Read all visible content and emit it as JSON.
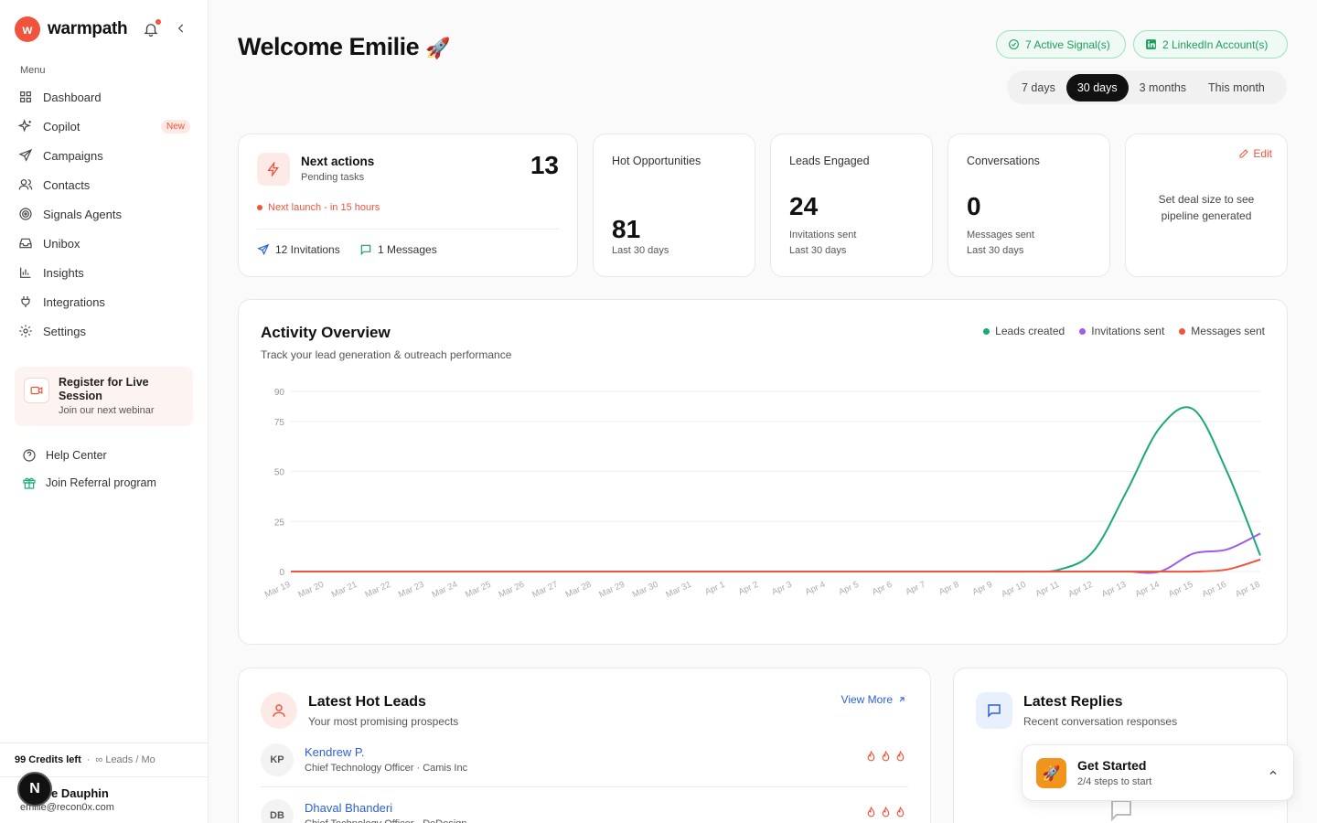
{
  "brand": {
    "logo_letter": "w",
    "name": "warmpath"
  },
  "sidebar": {
    "menu_label": "Menu",
    "items": [
      {
        "label": "Dashboard",
        "icon": "grid-icon"
      },
      {
        "label": "Copilot",
        "icon": "sparkles-icon",
        "badge": "New"
      },
      {
        "label": "Campaigns",
        "icon": "send-icon"
      },
      {
        "label": "Contacts",
        "icon": "users-icon"
      },
      {
        "label": "Signals Agents",
        "icon": "radar-icon"
      },
      {
        "label": "Unibox",
        "icon": "inbox-icon"
      },
      {
        "label": "Insights",
        "icon": "bar-chart-icon"
      },
      {
        "label": "Integrations",
        "icon": "plug-icon"
      },
      {
        "label": "Settings",
        "icon": "gear-icon"
      }
    ],
    "webinar": {
      "title": "Register for Live Session",
      "subtitle": "Join our next webinar"
    },
    "help": "Help Center",
    "referral": "Join Referral program",
    "credits": {
      "left": "99 Credits left",
      "sep": "·",
      "leads": "∞ Leads / Mo"
    },
    "user": {
      "name": "e Dauphin",
      "email": "emilie@recon0x.com",
      "badge": "N"
    }
  },
  "header": {
    "welcome": "Welcome Emilie",
    "rocket": "🚀",
    "signals_pill": "7 Active Signal(s)",
    "linkedin_pill": "2 LinkedIn Account(s)",
    "ranges": [
      "7 days",
      "30 days",
      "3 months",
      "This month"
    ],
    "active_range": "30 days"
  },
  "next_actions": {
    "title": "Next actions",
    "subtitle": "Pending tasks",
    "count": "13",
    "launch": "Next launch - in 15 hours",
    "invitations": "12 Invitations",
    "messages": "1 Messages"
  },
  "stats": [
    {
      "title": "Hot Opportunities",
      "value": "81",
      "sub1": "Last 30 days",
      "sub2": ""
    },
    {
      "title": "Leads Engaged",
      "value": "24",
      "sub1": "Invitations sent",
      "sub2": "Last 30 days"
    },
    {
      "title": "Conversations",
      "value": "0",
      "sub1": "Messages sent",
      "sub2": "Last 30 days"
    }
  ],
  "deal": {
    "edit": "Edit",
    "text": "Set deal size to see pipeline generated"
  },
  "activity": {
    "title": "Activity Overview",
    "subtitle": "Track your lead generation & outreach performance",
    "legend": [
      {
        "name": "Leads created",
        "color": "#1aa978"
      },
      {
        "name": "Invitations sent",
        "color": "#9b5de5"
      },
      {
        "name": "Messages sent",
        "color": "#f0543c"
      }
    ]
  },
  "chart_data": {
    "type": "line",
    "x": [
      "Mar 19",
      "Mar 20",
      "Mar 21",
      "Mar 22",
      "Mar 23",
      "Mar 24",
      "Mar 25",
      "Mar 26",
      "Mar 27",
      "Mar 28",
      "Mar 29",
      "Mar 30",
      "Mar 31",
      "Apr 1",
      "Apr 2",
      "Apr 3",
      "Apr 4",
      "Apr 5",
      "Apr 6",
      "Apr 7",
      "Apr 8",
      "Apr 9",
      "Apr 10",
      "Apr 11",
      "Apr 12",
      "Apr 13",
      "Apr 14",
      "Apr 15",
      "Apr 16",
      "Apr 18"
    ],
    "y_ticks": [
      0,
      25,
      50,
      75,
      90
    ],
    "ylim": [
      0,
      90
    ],
    "grid": true,
    "series": [
      {
        "name": "Leads created",
        "color": "#1aa978",
        "values": [
          0,
          0,
          0,
          0,
          0,
          0,
          0,
          0,
          0,
          0,
          0,
          0,
          0,
          0,
          0,
          0,
          0,
          0,
          0,
          0,
          0,
          0,
          0,
          1,
          10,
          40,
          72,
          81,
          50,
          8
        ]
      },
      {
        "name": "Invitations sent",
        "color": "#9b5de5",
        "values": [
          0,
          0,
          0,
          0,
          0,
          0,
          0,
          0,
          0,
          0,
          0,
          0,
          0,
          0,
          0,
          0,
          0,
          0,
          0,
          0,
          0,
          0,
          0,
          0,
          0,
          0,
          0,
          9,
          11,
          19
        ]
      },
      {
        "name": "Messages sent",
        "color": "#f0543c",
        "values": [
          0,
          0,
          0,
          0,
          0,
          0,
          0,
          0,
          0,
          0,
          0,
          0,
          0,
          0,
          0,
          0,
          0,
          0,
          0,
          0,
          0,
          0,
          0,
          0,
          0,
          0,
          0,
          0,
          1,
          6
        ]
      }
    ]
  },
  "hot_leads": {
    "title": "Latest Hot Leads",
    "subtitle": "Your most promising prospects",
    "view_more": "View More",
    "rows": [
      {
        "initials": "KP",
        "name": "Kendrew P.",
        "role": "Chief Technology Officer · Camis Inc"
      },
      {
        "initials": "DB",
        "name": "Dhaval Bhanderi",
        "role": "Chief Technology Officer · DeDesign"
      }
    ]
  },
  "replies": {
    "title": "Latest Replies",
    "subtitle": "Recent conversation responses"
  },
  "get_started": {
    "title": "Get Started",
    "subtitle": "2/4 steps to start",
    "icon": "🚀"
  }
}
